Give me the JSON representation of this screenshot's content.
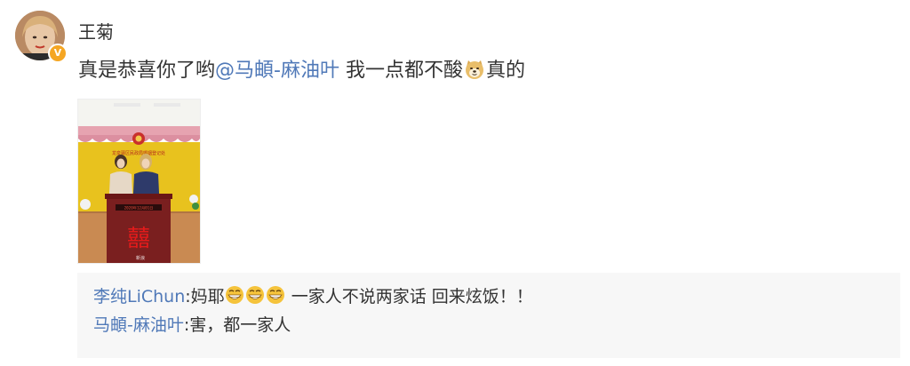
{
  "post": {
    "username": "王菊",
    "text_before": "真是恭喜你了哟",
    "mention": "@马頔-麻油叶",
    "text_middle": " 我一点都不酸",
    "text_after": "真的",
    "verified_badge": "V"
  },
  "photo": {
    "banner_text": "龙泉驿区民政局婚姻登记处",
    "podium_text": "2020年12月01日",
    "double_happiness": "囍",
    "watermark": "新浪"
  },
  "comments": [
    {
      "user": "李纯LiChun",
      "sep": ":",
      "text_before": "妈耶",
      "text_after": " 一家人不说两家话 回来炫饭！！"
    },
    {
      "user": "马頔-麻油叶",
      "sep": ":",
      "text": "害，都一家人"
    }
  ],
  "icons": {
    "dog_emoji": "doge-emoji-icon",
    "grin_emoji": "grin-emoji-icon"
  },
  "colors": {
    "link": "#5079b8",
    "badge": "#f5a623",
    "comment_bg": "#f7f7f7",
    "wall_yellow": "#e8c21e"
  }
}
